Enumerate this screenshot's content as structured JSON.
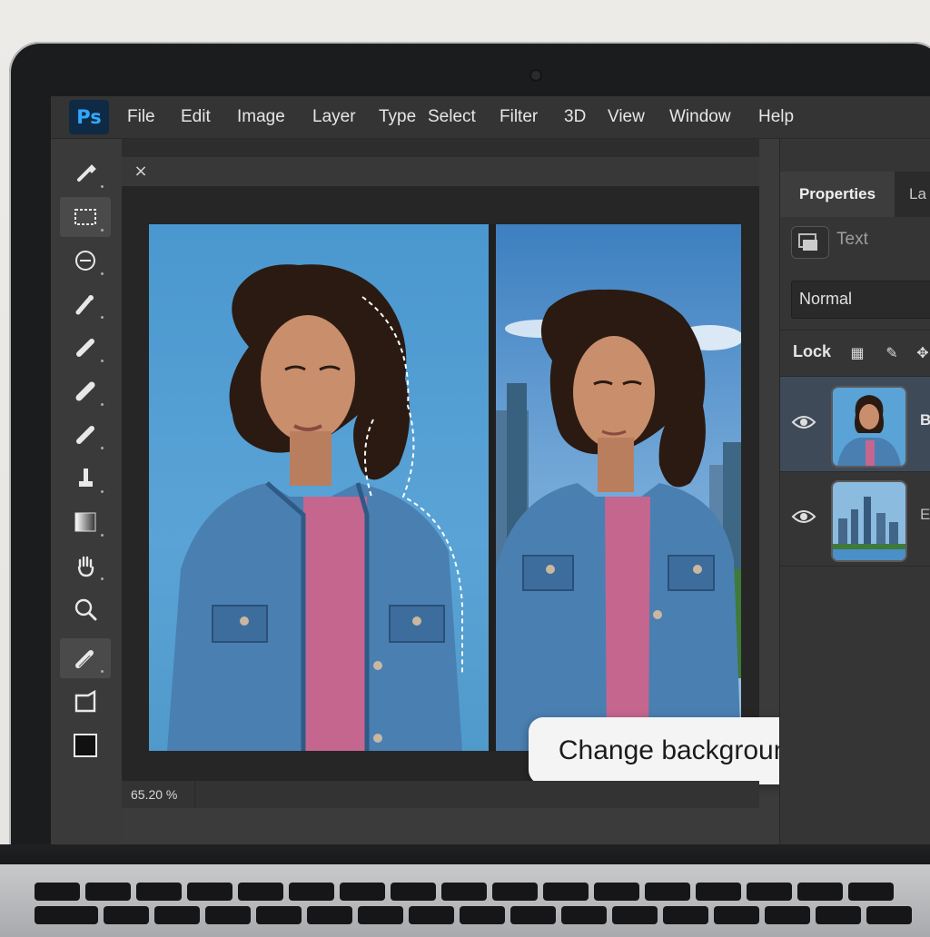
{
  "app": {
    "logo_text": "Ps",
    "menu": [
      "File",
      "Edit",
      "Image",
      "Layer",
      "Type",
      "Select",
      "Filter",
      "3D",
      "View",
      "Window",
      "Help"
    ]
  },
  "toolbar": {
    "tools": [
      "move-icon",
      "marquee-icon",
      "lasso-icon",
      "brush-icon",
      "spot-heal-icon",
      "eraser-icon",
      "pencil-icon",
      "stamp-icon",
      "gradient-icon",
      "hand-icon",
      "zoom-icon",
      "edit-pen-icon",
      "crop-frame-icon",
      "foreground-color-icon"
    ]
  },
  "document": {
    "close_glyph": "×",
    "zoom_level": "65.20 %",
    "action_pill": "Change background"
  },
  "panel": {
    "tab_properties": "Properties",
    "tab_layers": "La",
    "text_label": "Text",
    "blend_mode": "Normal",
    "lock_label": "Lock",
    "layers": [
      {
        "name": "B",
        "thumb": "woman-portrait"
      },
      {
        "name": "E",
        "thumb": "city-skyline"
      }
    ]
  },
  "colors": {
    "accent": "#31a8ff",
    "menubar": "#343434",
    "panel_bg": "#353535",
    "selection": "#3f4a59"
  }
}
